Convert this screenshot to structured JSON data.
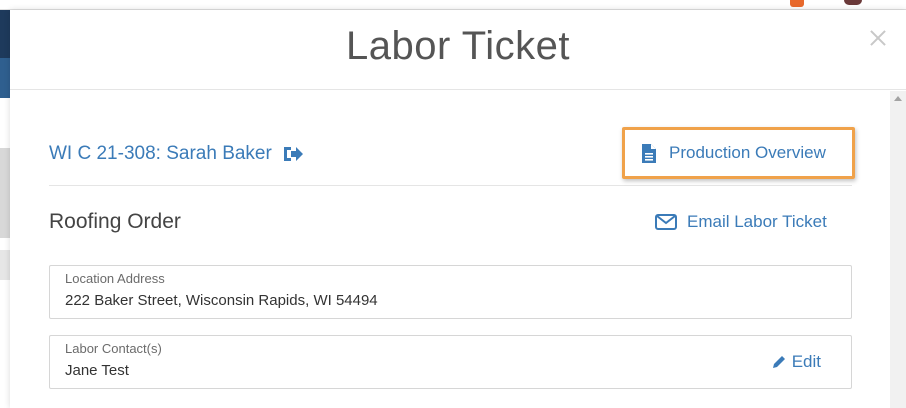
{
  "modal": {
    "title": "Labor Ticket"
  },
  "job": {
    "link_label": "WI C 21-308: Sarah Baker"
  },
  "actions": {
    "production_overview_label": "Production Overview",
    "email_label": "Email Labor Ticket",
    "edit_label": "Edit"
  },
  "section": {
    "title": "Roofing Order"
  },
  "fields": {
    "location": {
      "label": "Location Address",
      "value": "222 Baker Street, Wisconsin Rapids, WI 54494"
    },
    "contact": {
      "label": "Labor Contact(s)",
      "value": "Jane Test"
    }
  },
  "colors": {
    "link": "#3b7bb8",
    "highlight": "#f0a24a"
  }
}
